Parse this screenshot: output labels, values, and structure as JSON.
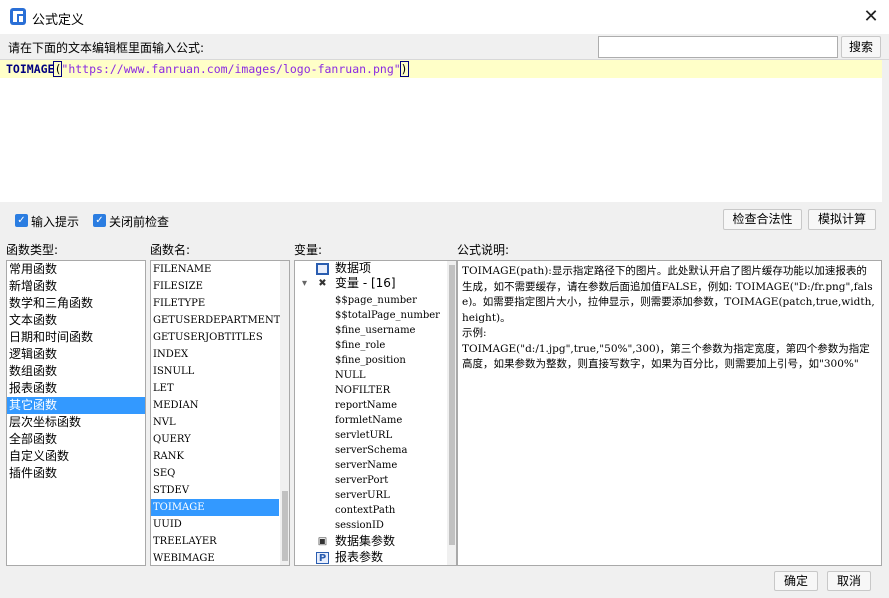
{
  "window": {
    "title": "公式定义",
    "close_symbol": "✕"
  },
  "prompt": {
    "label": "请在下面的文本编辑框里面输入公式:"
  },
  "search": {
    "value": "",
    "placeholder": "",
    "button_label": "搜索"
  },
  "editor": {
    "function_name": "TOIMAGE",
    "open_paren": "(",
    "argument": "\"https://www.fanruan.com/images/logo-fanruan.png\"",
    "close_paren": ")"
  },
  "options": {
    "input_hint": {
      "label": "输入提示",
      "checked": true
    },
    "check_before_close": {
      "label": "关闭前检查",
      "checked": true
    }
  },
  "toolbar": {
    "check_validity_label": "检查合法性",
    "simulate_label": "模拟计算"
  },
  "headers": {
    "types": "函数类型:",
    "funcs": "函数名:",
    "vars": "变量:",
    "desc": "公式说明:"
  },
  "function_types": [
    "常用函数",
    "新增函数",
    "数学和三角函数",
    "文本函数",
    "日期和时间函数",
    "逻辑函数",
    "数组函数",
    "报表函数",
    "其它函数",
    "层次坐标函数",
    "全部函数",
    "自定义函数",
    "插件函数"
  ],
  "function_types_selected": "其它函数",
  "function_names": [
    "FILENAME",
    "FILESIZE",
    "FILETYPE",
    "GETUSERDEPARTMENTS",
    "GETUSERJOBTITLES",
    "INDEX",
    "ISNULL",
    "LET",
    "MEDIAN",
    "NVL",
    "QUERY",
    "RANK",
    "SEQ",
    "STDEV",
    "TOIMAGE",
    "UUID",
    "TREELAYER",
    "WEBIMAGE"
  ],
  "function_names_selected": "TOIMAGE",
  "variables": {
    "data_items_label": "数据项",
    "variables_label": "变量 - [16]",
    "variable_items": [
      "$$page_number",
      "$$totalPage_number",
      "$fine_username",
      "$fine_role",
      "$fine_position",
      "NULL",
      "NOFILTER",
      "reportName",
      "formletName",
      "servletURL",
      "serverSchema",
      "serverName",
      "serverPort",
      "serverURL",
      "contextPath",
      "sessionID"
    ],
    "dataset_params_label": "数据集参数",
    "report_params_label": "报表参数",
    "expand_symbol": "▾",
    "report_params_icon_text": "P"
  },
  "description": "TOIMAGE(path):显示指定路径下的图片。此处默认开启了图片缓存功能以加速报表的生成，如不需要缓存，请在参数后面追加值FALSE，例如: TOIMAGE(\"D:/fr.png\",false)。如需要指定图片大小，拉伸显示，则需要添加参数，TOIMAGE(patch,true,width,height)。\n示例:\nTOIMAGE(\"d:/1.jpg\",true,\"50%\",300)，第三个参数为指定宽度，第四个参数为指定高度，如果参数为整数，则直接写数字，如果为百分比，则需要加上引号，如\"300%\"",
  "footer": {
    "ok_label": "确定",
    "cancel_label": "取消"
  },
  "colors": {
    "accent": "#3399ff",
    "editor_highlight": "#ffffc8",
    "string_literal": "#8a2be2",
    "function_keyword": "#000080"
  }
}
